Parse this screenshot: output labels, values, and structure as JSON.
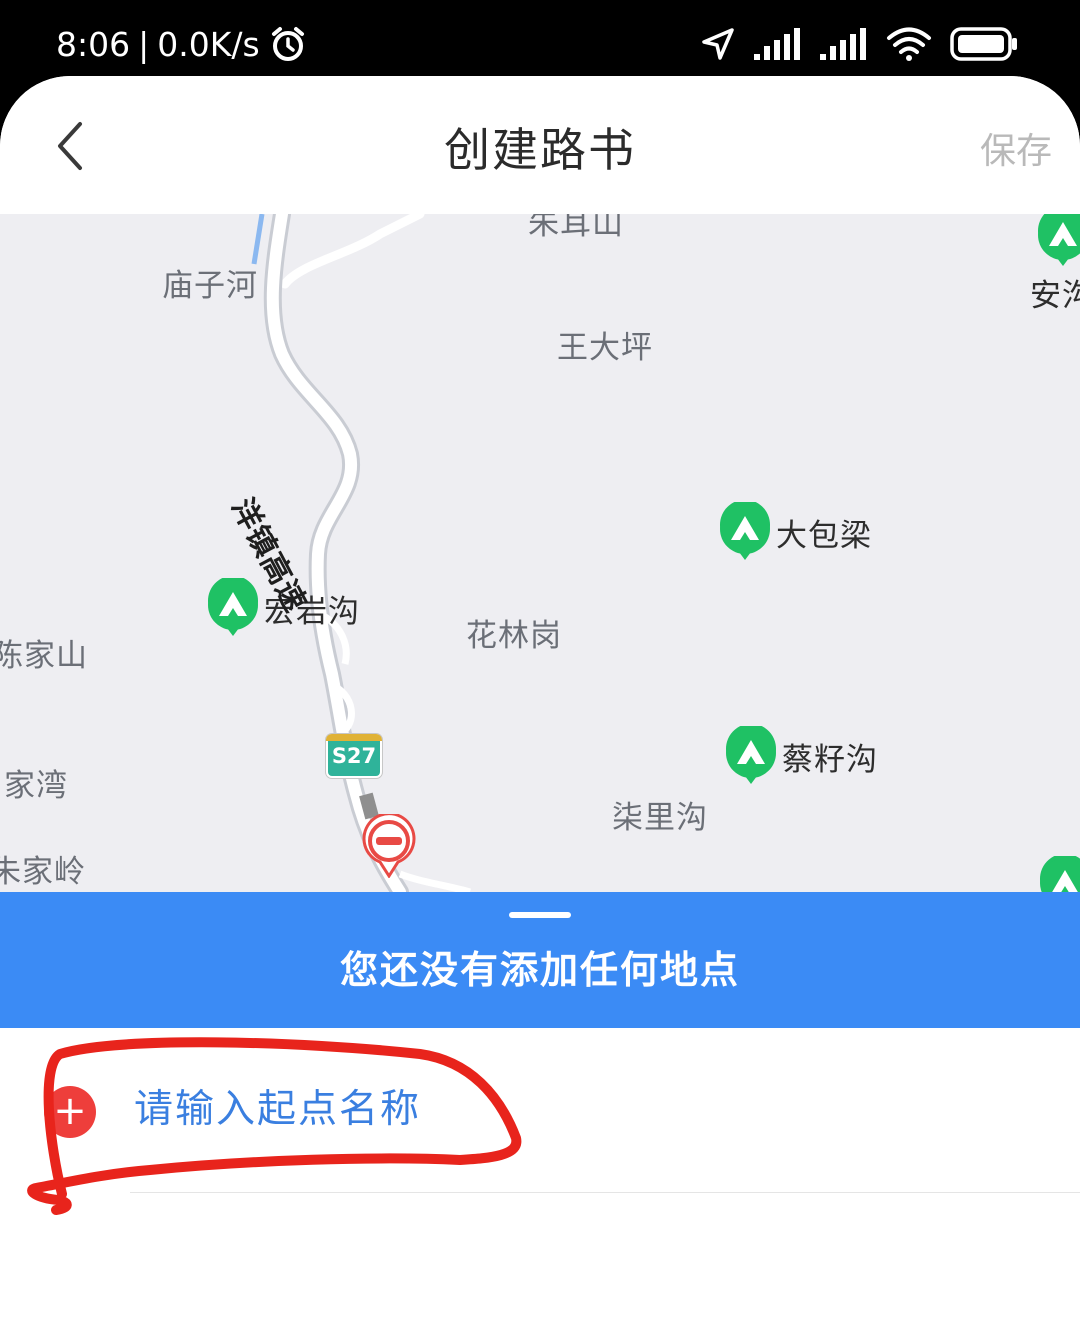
{
  "status_bar": {
    "time": "8:06",
    "speed": "0.0K/s"
  },
  "header": {
    "title": "创建路书",
    "save_label": "保存"
  },
  "map": {
    "place_labels": [
      "朱耳山",
      "庙子河",
      "王大坪",
      "花林岗",
      "陈家山",
      "家湾",
      "朱家岭",
      "柒里沟",
      "安沟"
    ],
    "poi_labels": [
      "大包梁",
      "宏岩沟",
      "蔡籽沟"
    ],
    "road_name": "洋镇高速",
    "road_shield": "S27"
  },
  "panel": {
    "empty_text": "您还没有添加任何地点"
  },
  "start": {
    "add_symbol": "+",
    "placeholder": "请输入起点名称"
  },
  "colors": {
    "accent_blue": "#3b8bf5",
    "poi_green": "#1fc164",
    "add_red": "#ee3e3b",
    "annotation_red": "#e8241c"
  }
}
